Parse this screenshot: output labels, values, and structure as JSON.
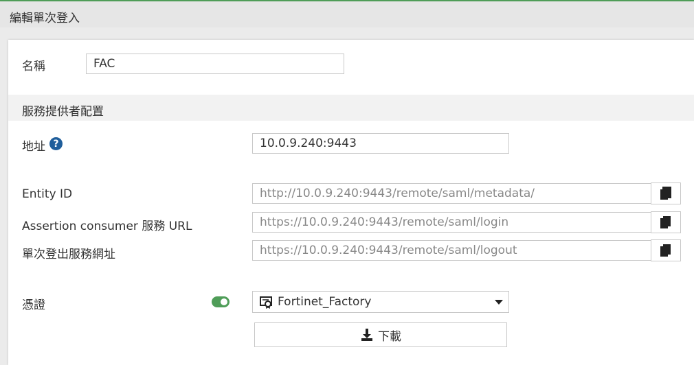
{
  "header": {
    "title": "編輯單次登入"
  },
  "form": {
    "name_label": "名稱",
    "name_value": "FAC",
    "section_title": "服務提供者配置",
    "address_label": "地址",
    "address_value": "10.0.9.240:9443",
    "entity_id_label": "Entity ID",
    "entity_id_value": "http://10.0.9.240:9443/remote/saml/metadata/",
    "acs_label": "Assertion consumer 服務 URL",
    "acs_value": "https://10.0.9.240:9443/remote/saml/login",
    "slo_label": "單次登出服務網址",
    "slo_value": "https://10.0.9.240:9443/remote/saml/logout",
    "certificate_label": "憑證",
    "certificate_enabled": true,
    "certificate_value": "Fortinet_Factory",
    "download_label": "下載"
  },
  "colors": {
    "accent_green": "#4f9d58",
    "help_blue": "#1f5e9b"
  }
}
